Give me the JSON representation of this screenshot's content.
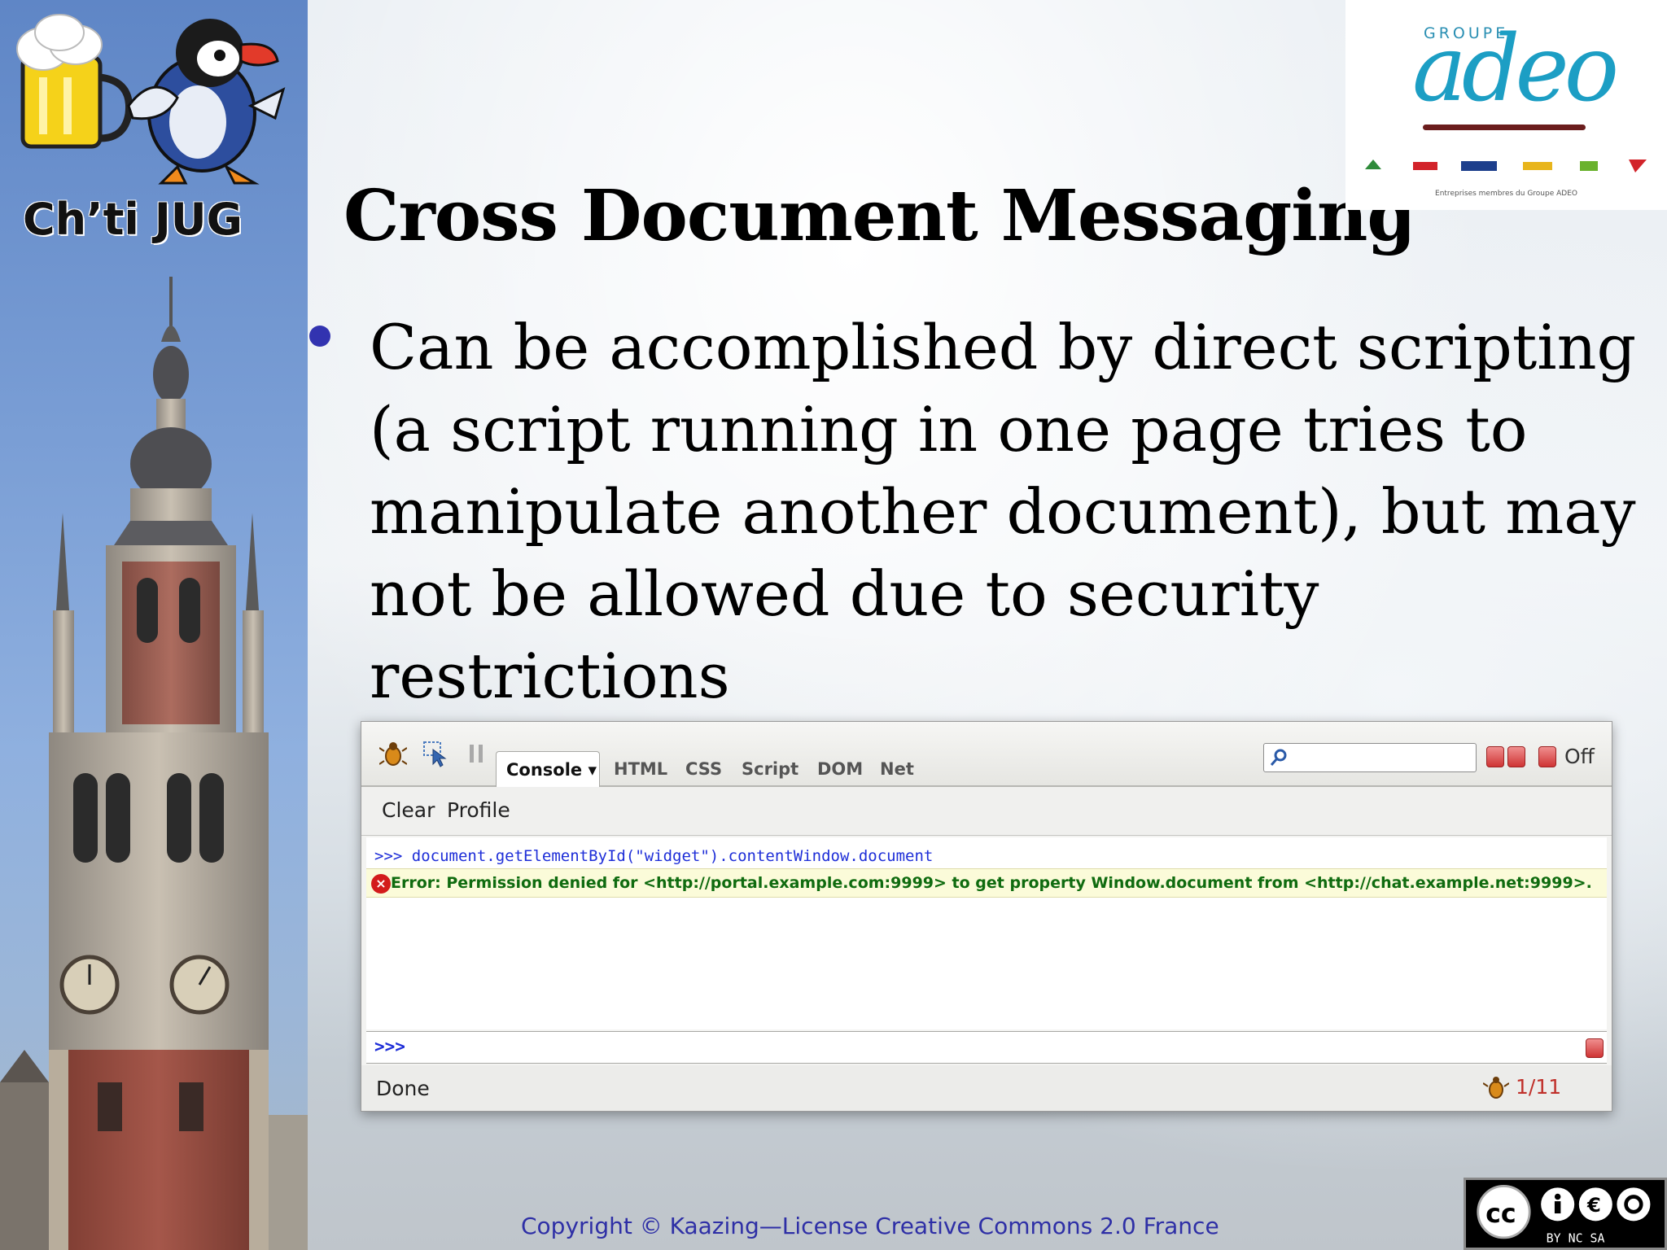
{
  "sidebar": {
    "title": "Ch’ti JUG"
  },
  "slide": {
    "title": "Cross Document Messaging",
    "bullet": "Can be accomplished by direct scripting (a script running in one page tries to manipulate another document), but may not be allowed due to security restrictions",
    "bullet_color": "#3233b0"
  },
  "logo": {
    "groupe": "GROUPE",
    "name": "adeo",
    "caption": "Entreprises membres du Groupe ADEO"
  },
  "firebug": {
    "tabs": {
      "console": "Console ▾",
      "html": "HTML",
      "css": "CSS",
      "script": "Script",
      "dom": "DOM",
      "net": "Net"
    },
    "off_label": "Off",
    "sub_buttons": {
      "clear": "Clear",
      "profile": "Profile"
    },
    "command": ">>> document.getElementById(\"widget\").contentWindow.document",
    "error": "Error: Permission denied for <http://portal.example.com:9999> to get property Window.document from <http://chat.example.net:9999>.",
    "prompt": ">>>",
    "status": "Done",
    "error_count": "1/11"
  },
  "footer": {
    "copyright": "Copyright © Kaazing—License Creative Commons 2.0 France",
    "cc_badge_text": "BY NC SA"
  },
  "colors": {
    "accent_blue": "#2e2fa6",
    "error_green": "#0f6b0f",
    "command_blue": "#1e2ed8",
    "adeo_blue": "#1c9ec4"
  }
}
